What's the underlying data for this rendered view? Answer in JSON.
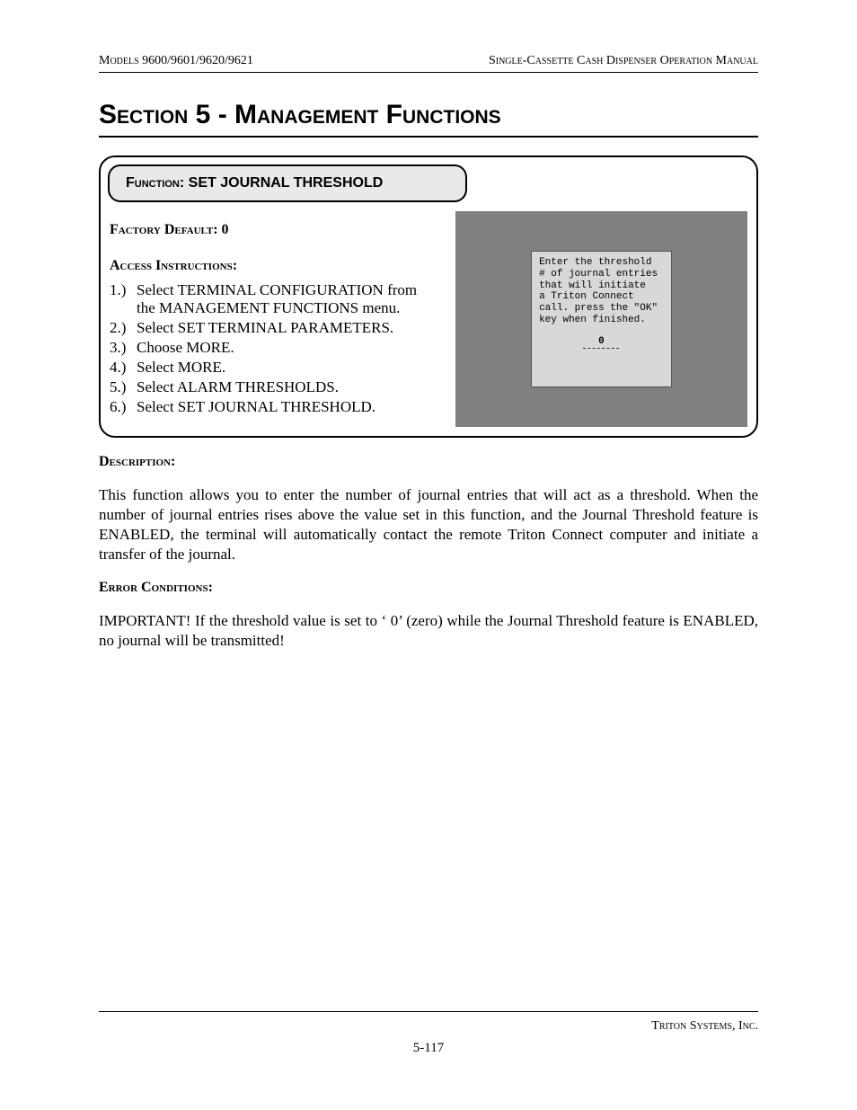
{
  "header": {
    "left": "Models 9600/9601/9620/9621",
    "right": "Single-Cassette Cash Dispenser Operation Manual"
  },
  "section_title": "Section 5 - Management Functions",
  "function_box": {
    "label_prefix": "Function:",
    "name": "SET JOURNAL THRESHOLD",
    "factory_default_label": "Factory Default:",
    "factory_default_value": "0",
    "access_label": "Access Instructions:",
    "instructions": [
      {
        "n": "1.)",
        "t": "Select TERMINAL CONFIGURATION from the MANAGEMENT FUNCTIONS menu."
      },
      {
        "n": "2.)",
        "t": "Select SET TERMINAL PARAMETERS."
      },
      {
        "n": "3.)",
        "t": "Choose MORE."
      },
      {
        "n": "4.)",
        "t": "Select MORE."
      },
      {
        "n": "5.)",
        "t": "Select ALARM THRESHOLDS."
      },
      {
        "n": "6.)",
        "t": "Select SET JOURNAL THRESHOLD."
      }
    ],
    "terminal_screen": {
      "l1": "Enter the threshold",
      "l2": "# of journal entries",
      "l3": "that will initiate",
      "l4": "a Triton Connect",
      "l5": "call. press the \"OK\"",
      "l6": "key when finished.",
      "value": "0"
    }
  },
  "description_label": "Description:",
  "description_text": "This function allows you to enter the number of journal entries that will act as a threshold. When the number of journal entries rises above the value set in this function, and the Journal Threshold feature is ENABLED, the terminal will automatically contact the remote Triton Connect computer and initiate a transfer of the journal.",
  "error_label": "Error Conditions:",
  "error_text": "IMPORTANT! If the threshold value is set to ‘ 0’ (zero) while the Journal Threshold feature is ENABLED, no journal will be transmitted!",
  "footer": {
    "company": "Triton Systems, Inc.",
    "page": "5-117"
  }
}
